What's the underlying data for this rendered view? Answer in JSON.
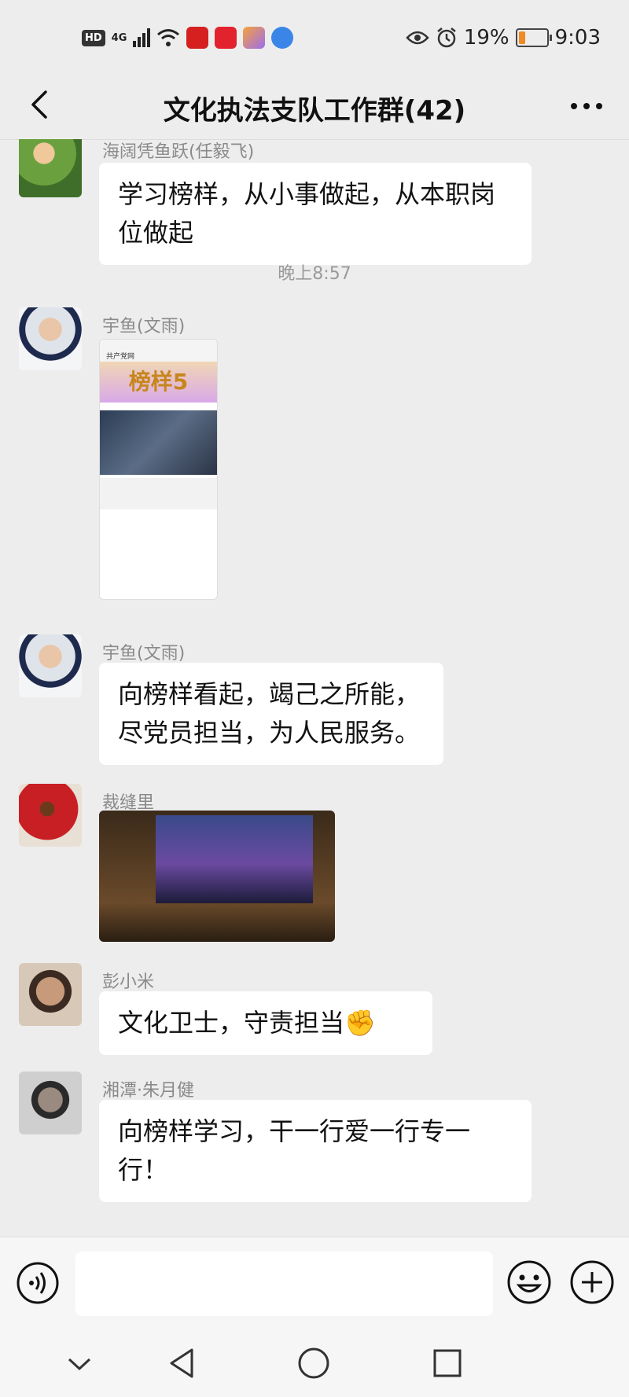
{
  "status_bar": {
    "hd": "HD",
    "network": "4G",
    "battery": "19%",
    "time": "9:03",
    "icons": [
      "signal-icon",
      "wifi-icon",
      "app-icon-red",
      "app-icon-heart",
      "app-icon-tag",
      "app-icon-globe",
      "eye-icon",
      "alarm-icon",
      "battery-icon"
    ]
  },
  "header": {
    "title": "文化执法支队工作群(42)",
    "back_icon": "back-arrow-icon",
    "more_icon": "more-dots-icon"
  },
  "messages": [
    {
      "sender": "海阔凭鱼跃(任毅飞)",
      "type": "text",
      "lines": [
        "学习榜样，从小事做起，从本职岗",
        "位做起"
      ]
    },
    {
      "type": "timestamp",
      "text": "晚上8:57"
    },
    {
      "sender": "宇鱼(文雨)",
      "type": "image",
      "image_text": "榜样5",
      "image_app_text": "共产党网"
    },
    {
      "sender": "宇鱼(文雨)",
      "type": "text",
      "lines": [
        "向榜样看起，竭己之所能，",
        "尽党员担当，为人民服务。"
      ]
    },
    {
      "sender": "裁缝里",
      "type": "image",
      "image_desc": "tv-screen-photo"
    },
    {
      "sender": "彭小米",
      "type": "text",
      "lines": [
        "文化卫士，守责担当✊"
      ]
    },
    {
      "sender": "湘潭·朱月健",
      "type": "text",
      "lines": [
        "向榜样学习，干一行爱一行专一",
        "行！"
      ]
    }
  ],
  "input_bar": {
    "voice_icon": "voice-icon",
    "text_value": "",
    "emoji_icon": "emoji-icon",
    "plus_icon": "plus-icon"
  },
  "nav_bar": {
    "icons": [
      "nav-hide-icon",
      "nav-back-icon",
      "nav-home-icon",
      "nav-recents-icon"
    ]
  },
  "colors": {
    "background": "#ededed",
    "bubble": "#ffffff",
    "sender": "#8a8a8a"
  }
}
